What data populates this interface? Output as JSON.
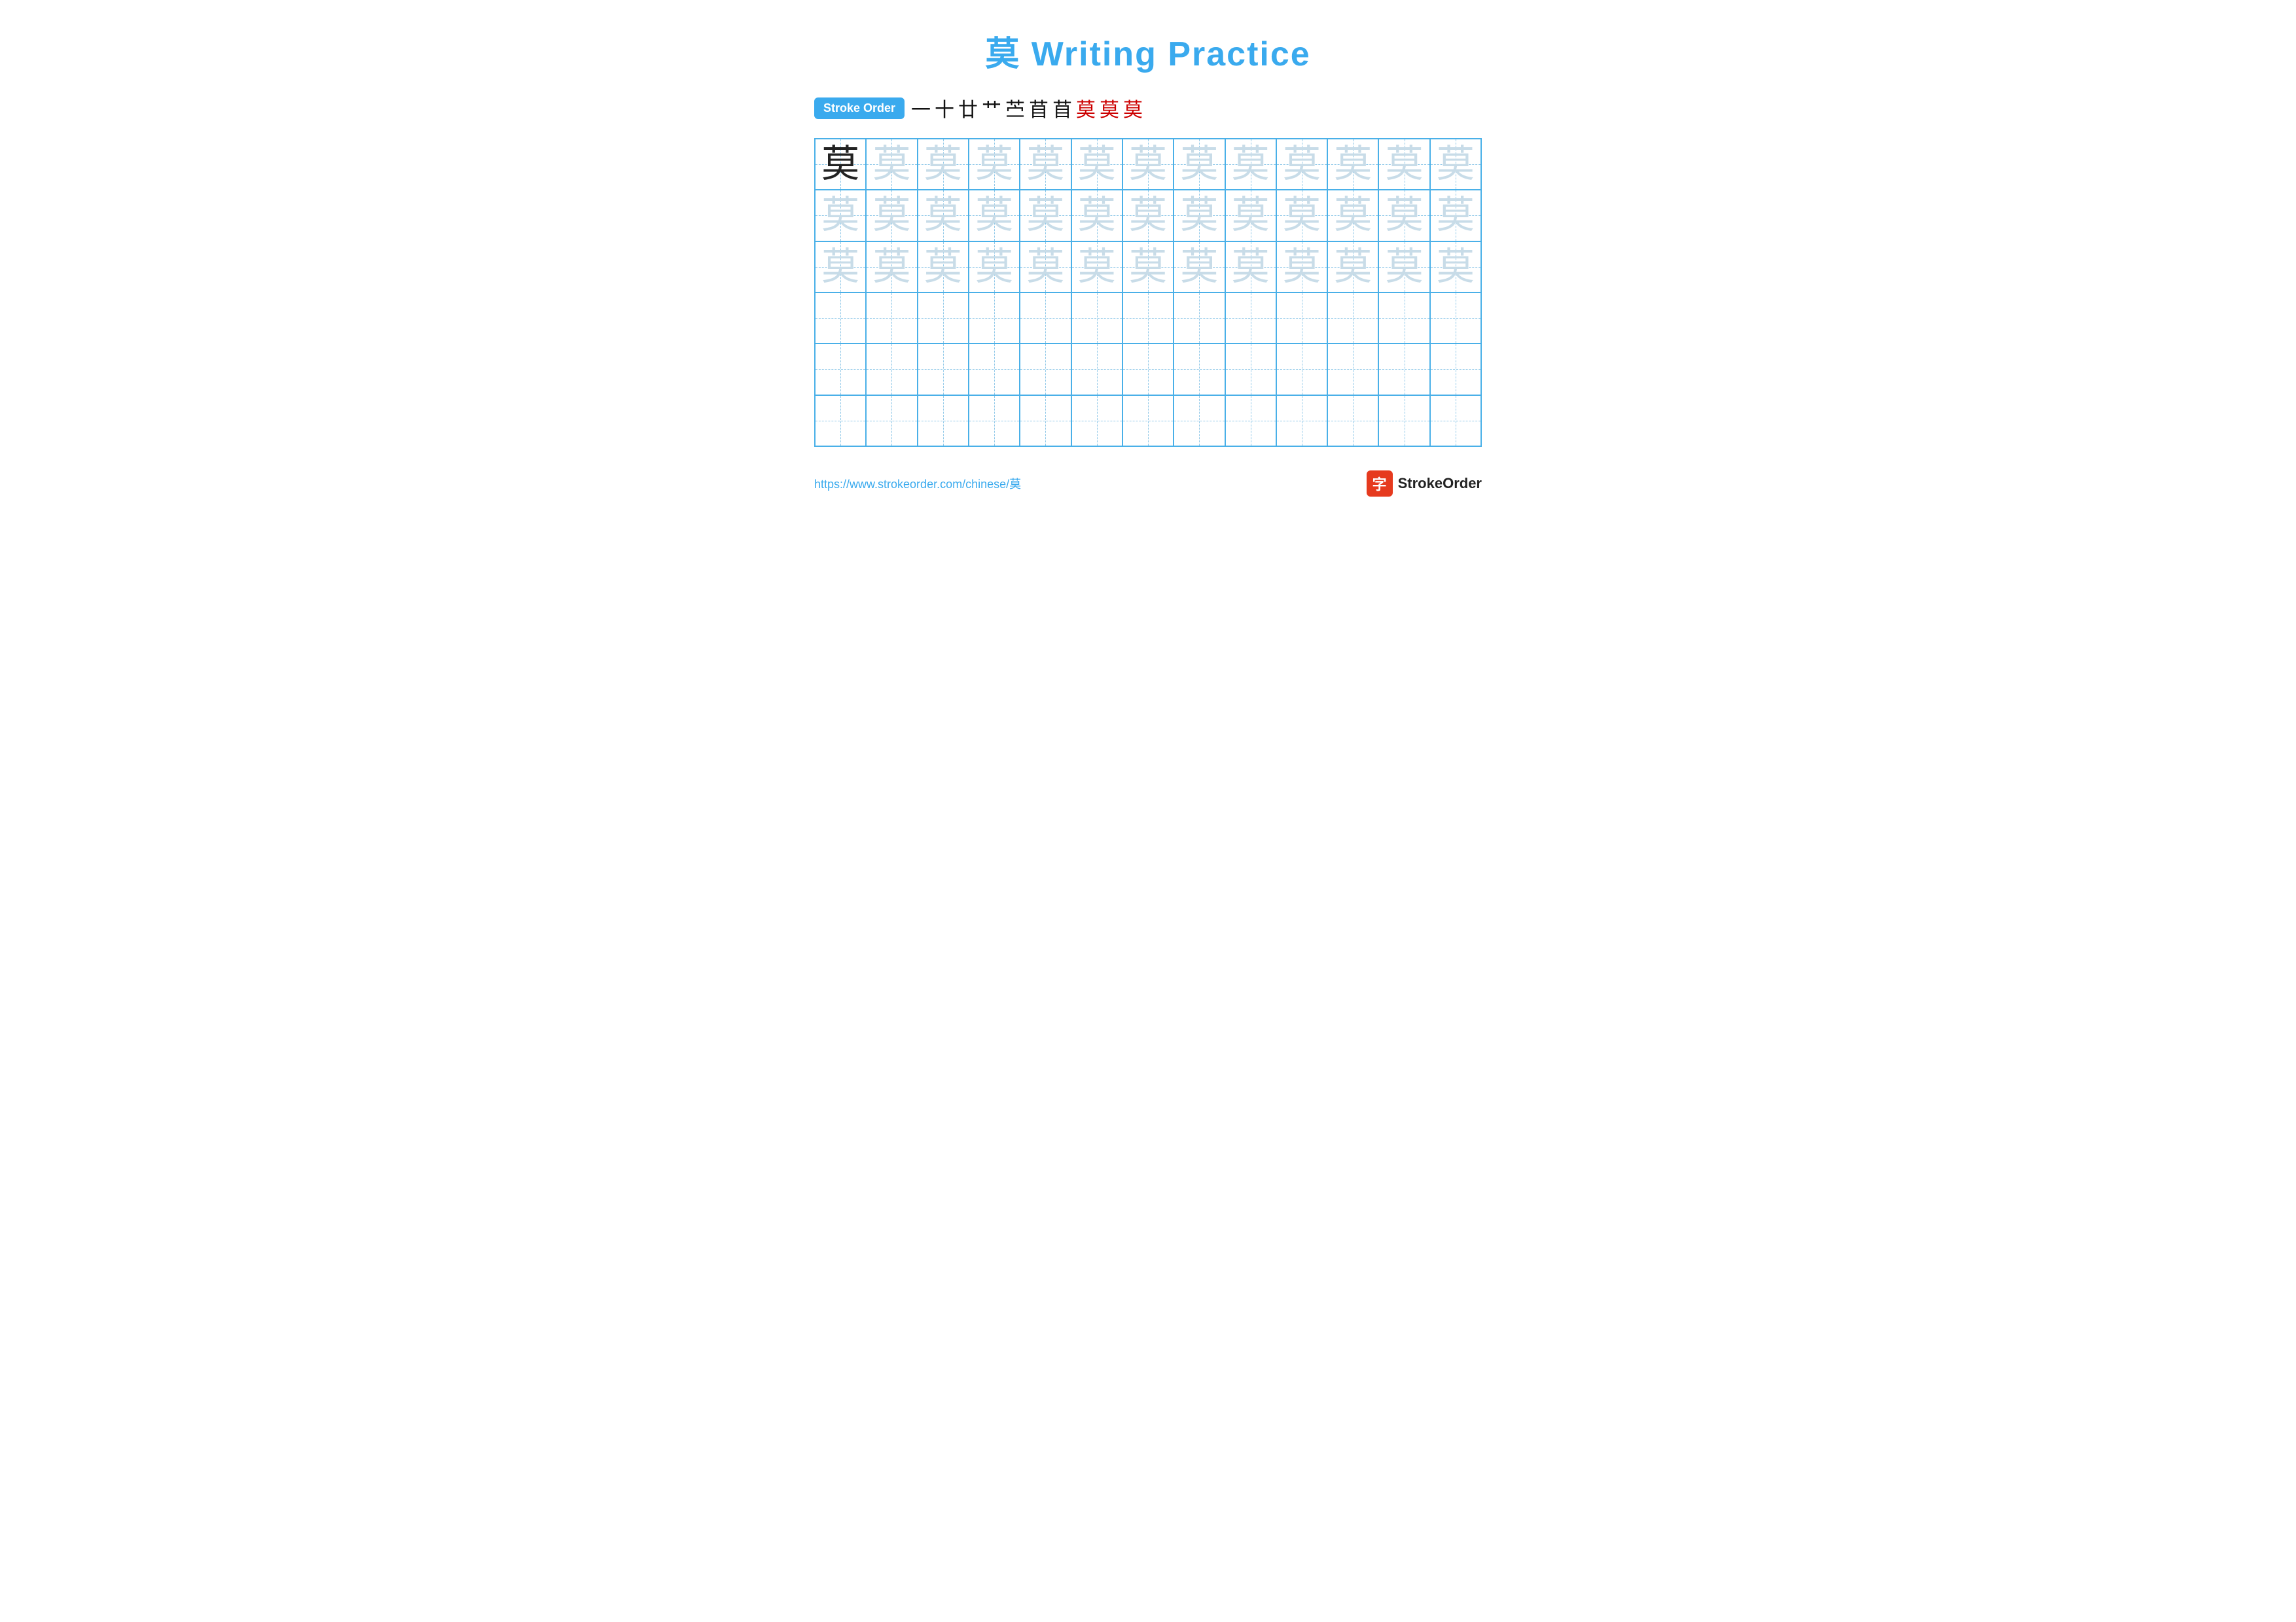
{
  "title": {
    "text": "莫 Writing Practice"
  },
  "stroke_order": {
    "badge_label": "Stroke Order",
    "strokes": [
      {
        "char": "一",
        "color": "black"
      },
      {
        "char": "十",
        "color": "black"
      },
      {
        "char": "廿",
        "color": "black"
      },
      {
        "char": "艹",
        "color": "black"
      },
      {
        "char": "苎",
        "color": "black"
      },
      {
        "char": "苜",
        "color": "black"
      },
      {
        "char": "苜",
        "color": "black"
      },
      {
        "char": "莫",
        "color": "red"
      },
      {
        "char": "莫",
        "color": "red"
      },
      {
        "char": "莫",
        "color": "red"
      }
    ]
  },
  "grid": {
    "rows": 6,
    "cols": 13,
    "chars": [
      [
        {
          "char": "莫",
          "style": "dark"
        },
        {
          "char": "莫",
          "style": "light"
        },
        {
          "char": "莫",
          "style": "light"
        },
        {
          "char": "莫",
          "style": "light"
        },
        {
          "char": "莫",
          "style": "light"
        },
        {
          "char": "莫",
          "style": "light"
        },
        {
          "char": "莫",
          "style": "light"
        },
        {
          "char": "莫",
          "style": "light"
        },
        {
          "char": "莫",
          "style": "light"
        },
        {
          "char": "莫",
          "style": "light"
        },
        {
          "char": "莫",
          "style": "light"
        },
        {
          "char": "莫",
          "style": "light"
        },
        {
          "char": "莫",
          "style": "light"
        }
      ],
      [
        {
          "char": "莫",
          "style": "light"
        },
        {
          "char": "莫",
          "style": "light"
        },
        {
          "char": "莫",
          "style": "light"
        },
        {
          "char": "莫",
          "style": "light"
        },
        {
          "char": "莫",
          "style": "light"
        },
        {
          "char": "莫",
          "style": "light"
        },
        {
          "char": "莫",
          "style": "light"
        },
        {
          "char": "莫",
          "style": "light"
        },
        {
          "char": "莫",
          "style": "light"
        },
        {
          "char": "莫",
          "style": "light"
        },
        {
          "char": "莫",
          "style": "light"
        },
        {
          "char": "莫",
          "style": "light"
        },
        {
          "char": "莫",
          "style": "light"
        }
      ],
      [
        {
          "char": "莫",
          "style": "light"
        },
        {
          "char": "莫",
          "style": "light"
        },
        {
          "char": "莫",
          "style": "light"
        },
        {
          "char": "莫",
          "style": "light"
        },
        {
          "char": "莫",
          "style": "light"
        },
        {
          "char": "莫",
          "style": "light"
        },
        {
          "char": "莫",
          "style": "light"
        },
        {
          "char": "莫",
          "style": "light"
        },
        {
          "char": "莫",
          "style": "light"
        },
        {
          "char": "莫",
          "style": "light"
        },
        {
          "char": "莫",
          "style": "light"
        },
        {
          "char": "莫",
          "style": "light"
        },
        {
          "char": "莫",
          "style": "light"
        }
      ],
      [
        {
          "char": "",
          "style": "empty"
        },
        {
          "char": "",
          "style": "empty"
        },
        {
          "char": "",
          "style": "empty"
        },
        {
          "char": "",
          "style": "empty"
        },
        {
          "char": "",
          "style": "empty"
        },
        {
          "char": "",
          "style": "empty"
        },
        {
          "char": "",
          "style": "empty"
        },
        {
          "char": "",
          "style": "empty"
        },
        {
          "char": "",
          "style": "empty"
        },
        {
          "char": "",
          "style": "empty"
        },
        {
          "char": "",
          "style": "empty"
        },
        {
          "char": "",
          "style": "empty"
        },
        {
          "char": "",
          "style": "empty"
        }
      ],
      [
        {
          "char": "",
          "style": "empty"
        },
        {
          "char": "",
          "style": "empty"
        },
        {
          "char": "",
          "style": "empty"
        },
        {
          "char": "",
          "style": "empty"
        },
        {
          "char": "",
          "style": "empty"
        },
        {
          "char": "",
          "style": "empty"
        },
        {
          "char": "",
          "style": "empty"
        },
        {
          "char": "",
          "style": "empty"
        },
        {
          "char": "",
          "style": "empty"
        },
        {
          "char": "",
          "style": "empty"
        },
        {
          "char": "",
          "style": "empty"
        },
        {
          "char": "",
          "style": "empty"
        },
        {
          "char": "",
          "style": "empty"
        }
      ],
      [
        {
          "char": "",
          "style": "empty"
        },
        {
          "char": "",
          "style": "empty"
        },
        {
          "char": "",
          "style": "empty"
        },
        {
          "char": "",
          "style": "empty"
        },
        {
          "char": "",
          "style": "empty"
        },
        {
          "char": "",
          "style": "empty"
        },
        {
          "char": "",
          "style": "empty"
        },
        {
          "char": "",
          "style": "empty"
        },
        {
          "char": "",
          "style": "empty"
        },
        {
          "char": "",
          "style": "empty"
        },
        {
          "char": "",
          "style": "empty"
        },
        {
          "char": "",
          "style": "empty"
        },
        {
          "char": "",
          "style": "empty"
        }
      ]
    ]
  },
  "footer": {
    "url": "https://www.strokeorder.com/chinese/莫",
    "brand_label": "StrokeOrder",
    "brand_icon_char": "字"
  }
}
